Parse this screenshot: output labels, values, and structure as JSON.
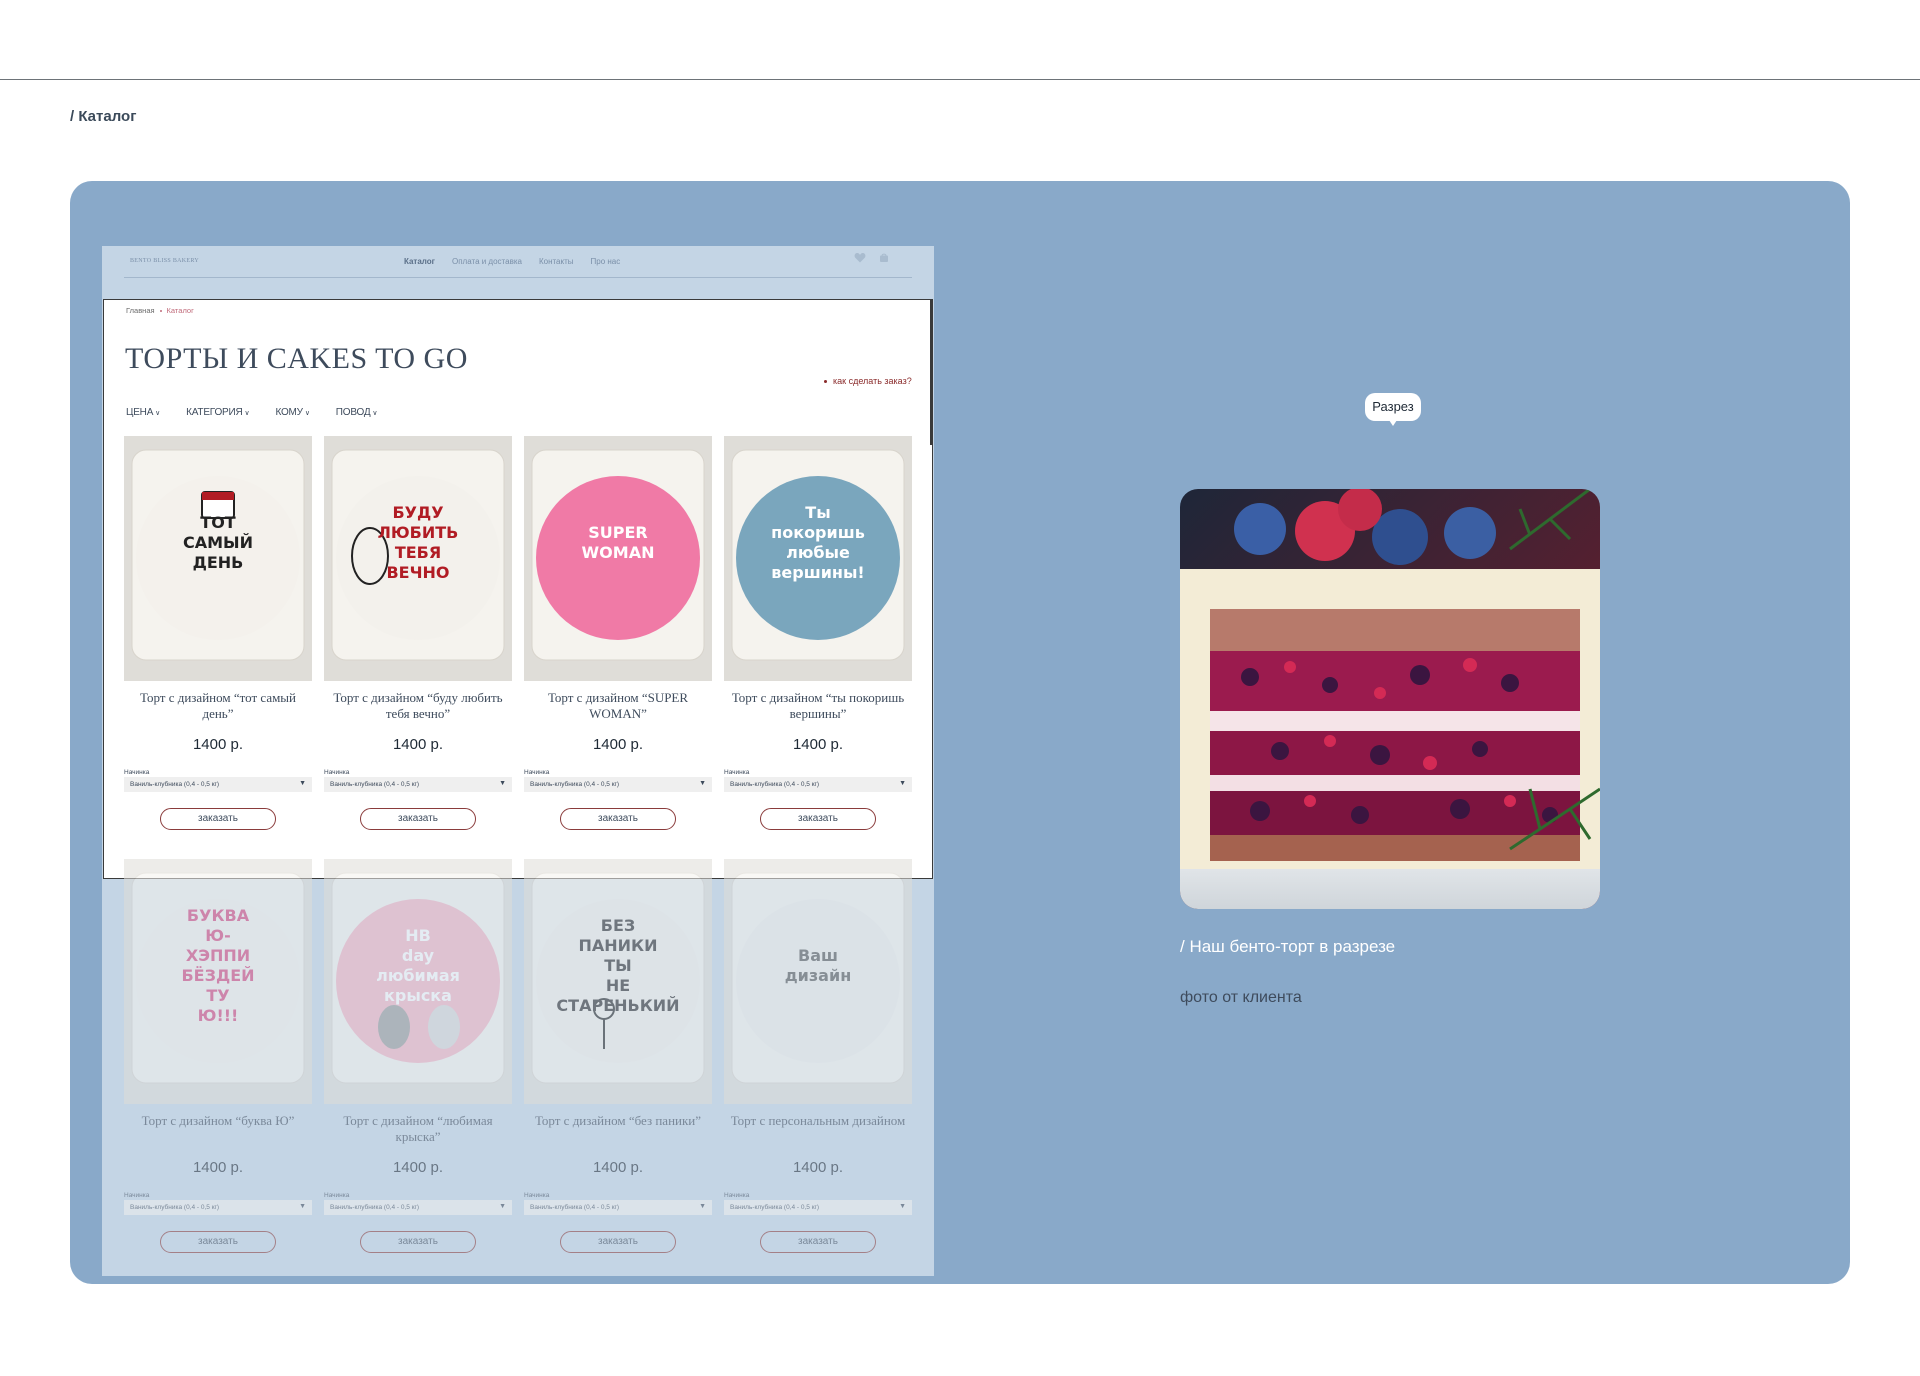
{
  "page": {
    "breadcrumb": "/ Каталог"
  },
  "site": {
    "brand": "BENTO BLISS BAKERY",
    "nav": [
      "Каталог",
      "Оплата и доставка",
      "Контакты",
      "Про нас"
    ],
    "breadcrumb": {
      "home": "Главная",
      "current": "Каталог"
    },
    "title": "ТОРТЫ И CAKES TO GO",
    "howto_link": "как сделать заказ?",
    "filters": [
      "ЦЕНА",
      "КАТЕГОРИЯ",
      "КОМУ",
      "ПОВОД"
    ],
    "filling_label": "Начинка",
    "filling_value": "Ваниль-клубника (0,4 - 0,5 кг)",
    "order_label": "заказать",
    "products": [
      {
        "title": "Торт с дизайном “тот самый день”",
        "price": "1400 р.",
        "icing": "#f4f1ec",
        "text": "ТОТ САМЫЙ ДЕНЬ",
        "text_color": "#222222",
        "icon": "calendar-icon"
      },
      {
        "title": "Торт с дизайном “буду любить тебя вечно”",
        "price": "1400 р.",
        "icing": "#f3f1ec",
        "text": "БУДУ ЛЮБИТЬ ТЕБЯ ВЕЧНО",
        "text_color": "#b11c24",
        "icon": "doodle-icon"
      },
      {
        "title": "Торт с дизайном “SUPER WOMAN”",
        "price": "1400 р.",
        "icing": "#f07aa6",
        "text": "SUPER WOMAN",
        "text_color": "#ffffff",
        "icon": "none"
      },
      {
        "title": "Торт с дизайном “ты покоришь вершины”",
        "price": "1400 р.",
        "icing": "#7aa6bd",
        "text": "Ты покоришь любые вершины!",
        "text_color": "#ffffff",
        "icon": "none"
      },
      {
        "title": "Торт с дизайном “буква Ю”",
        "price": "1400 р.",
        "icing": "#f4f1ec",
        "text": "БУКВА Ю- ХЭППИ БЁЗДЕЙ ТУ Ю!!!",
        "text_color": "#d6457c",
        "icon": "none"
      },
      {
        "title": "Торт с дизайном “любимая крыска”",
        "price": "1400 р.",
        "icing": "#f4b3c2",
        "text": "HB day любимая крыска",
        "text_color": "#ffffff",
        "icon": "rat-icon"
      },
      {
        "title": "Торт с дизайном “без паники”",
        "price": "1400 р.",
        "icing": "#f2efea",
        "text": "БЕЗ ПАНИКИ ТЫ НЕ СТАРЕНЬКИЙ",
        "text_color": "#2a2a2a",
        "icon": "stickman-icon"
      },
      {
        "title": "Торт с персональным дизайном",
        "price": "1400 р.",
        "icing": "#eeeeea",
        "text": "Ваш дизайн",
        "text_color": "#555555",
        "icon": "none"
      }
    ]
  },
  "cut": {
    "tooltip": "Разрез",
    "caption": "/ Наш бенто-торт в разрезе",
    "subcaption": "фото от клиента"
  },
  "colors": {
    "board": "#89a9c9",
    "site_bg": "#c4d5e5",
    "accent": "#8a2b2b"
  }
}
